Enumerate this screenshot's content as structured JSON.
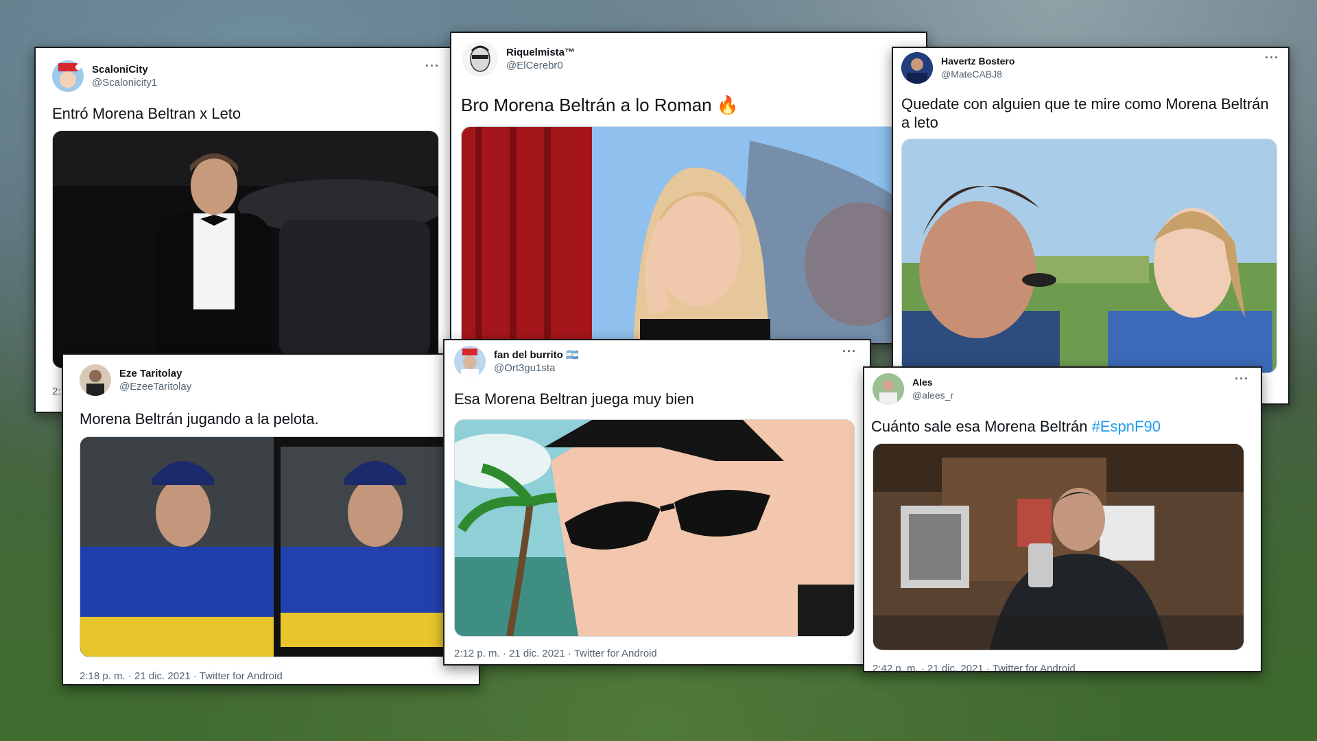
{
  "tweets": [
    {
      "id": "t1",
      "display_name": "ScaloniCity",
      "handle": "@Scalonicity1",
      "text": "Entró Morena Beltran x Leto",
      "meta": "2:1",
      "more": "···"
    },
    {
      "id": "t2",
      "display_name": "Riquelmista™",
      "handle": "@ElCerebr0",
      "text": "Bro Morena Beltrán a lo Roman",
      "emoji": "🔥",
      "more": ""
    },
    {
      "id": "t3",
      "display_name": "Havertz Bostero",
      "handle": "@MateCABJ8",
      "text": "Quedate con alguien que te mire como Morena Beltrán a leto",
      "more": "···"
    },
    {
      "id": "t4",
      "display_name": "Eze Taritolay",
      "handle": "@EzeeTaritolay",
      "text": "Morena Beltrán jugando a la pelota.",
      "meta": "2:18 p. m. · 21 dic. 2021 · Twitter for Android",
      "more": ""
    },
    {
      "id": "t5",
      "display_name": "fan del burrito 🇦🇷",
      "handle": "@Ort3gu1sta",
      "text": "Esa Morena Beltran juega muy bien",
      "meta": "2:12 p. m. · 21 dic. 2021 · Twitter for Android",
      "more": "···"
    },
    {
      "id": "t6",
      "display_name": "Ales",
      "handle": "@alees_r",
      "text": "Cuánto sale esa Morena Beltrán ",
      "hashtag": "#EspnF90",
      "meta": "2:42 p. m. · 21 dic. 2021 · Twitter for Android",
      "more": "···"
    }
  ],
  "media": {
    "t1": "photo-man-in-tuxedo-by-car",
    "t2": "photo-woman-hand-on-forehead",
    "t3": "photo-man-and-woman-interview",
    "t4": "photo-man-in-boca-jersey-two-panel",
    "t5": "cartoon-character-with-sunglasses",
    "t6": "photo-man-with-phone-in-office"
  },
  "colors": {
    "link": "#1d9bf0",
    "text": "#0f1419",
    "muted": "#536471"
  }
}
